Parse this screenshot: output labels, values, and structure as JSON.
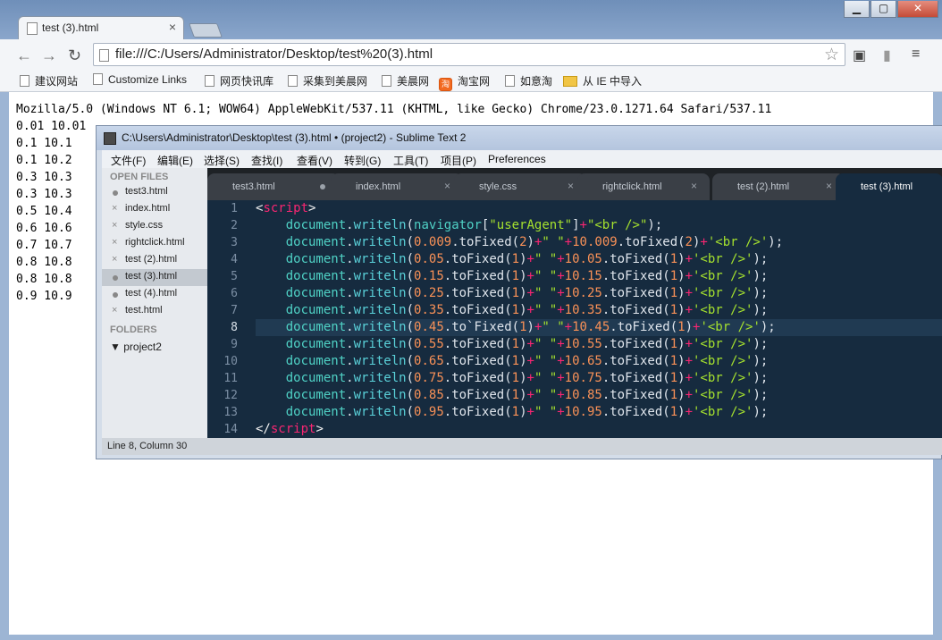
{
  "browser": {
    "tab_title": "test (3).html",
    "url": "file:///C:/Users/Administrator/Desktop/test%20(3).html",
    "bookmarks": [
      "建议网站",
      "Customize Links",
      "网页快讯库",
      "采集到美晨网",
      "美晨网",
      "淘宝网",
      "如意淘",
      "从 IE 中导入"
    ],
    "output_lines": [
      "Mozilla/5.0 (Windows NT 6.1; WOW64) AppleWebKit/537.11 (KHTML, like Gecko) Chrome/23.0.1271.64 Safari/537.11",
      "0.01 10.01",
      "0.1 10.1",
      "0.1 10.2",
      "0.3 10.3",
      "0.3 10.3",
      "0.5 10.4",
      "0.6 10.6",
      "0.7 10.7",
      "0.8 10.8",
      "0.8 10.8",
      "0.9 10.9"
    ]
  },
  "sublime": {
    "title": "C:\\Users\\Administrator\\Desktop\\test (3).html • (project2) - Sublime Text 2",
    "menu": [
      "文件(F)",
      "编辑(E)",
      "选择(S)",
      "查找(I)",
      "查看(V)",
      "转到(G)",
      "工具(T)",
      "项目(P)",
      "Preferences"
    ],
    "sidebar": {
      "open_files_label": "OPEN FILES",
      "files": [
        "test3.html",
        "index.html",
        "style.css",
        "rightclick.html",
        "test (2).html",
        "test (3).html",
        "test (4).html",
        "test.html"
      ],
      "folders_label": "FOLDERS",
      "folder": "project2"
    },
    "tabs": [
      "test3.html",
      "index.html",
      "style.css",
      "rightclick.html",
      "test (2).html",
      "test (3).html"
    ],
    "line_numbers": [
      "1",
      "2",
      "3",
      "4",
      "5",
      "6",
      "7",
      "8",
      "9",
      "10",
      "11",
      "12",
      "13",
      "14"
    ],
    "status": "Line 8, Column 30"
  }
}
